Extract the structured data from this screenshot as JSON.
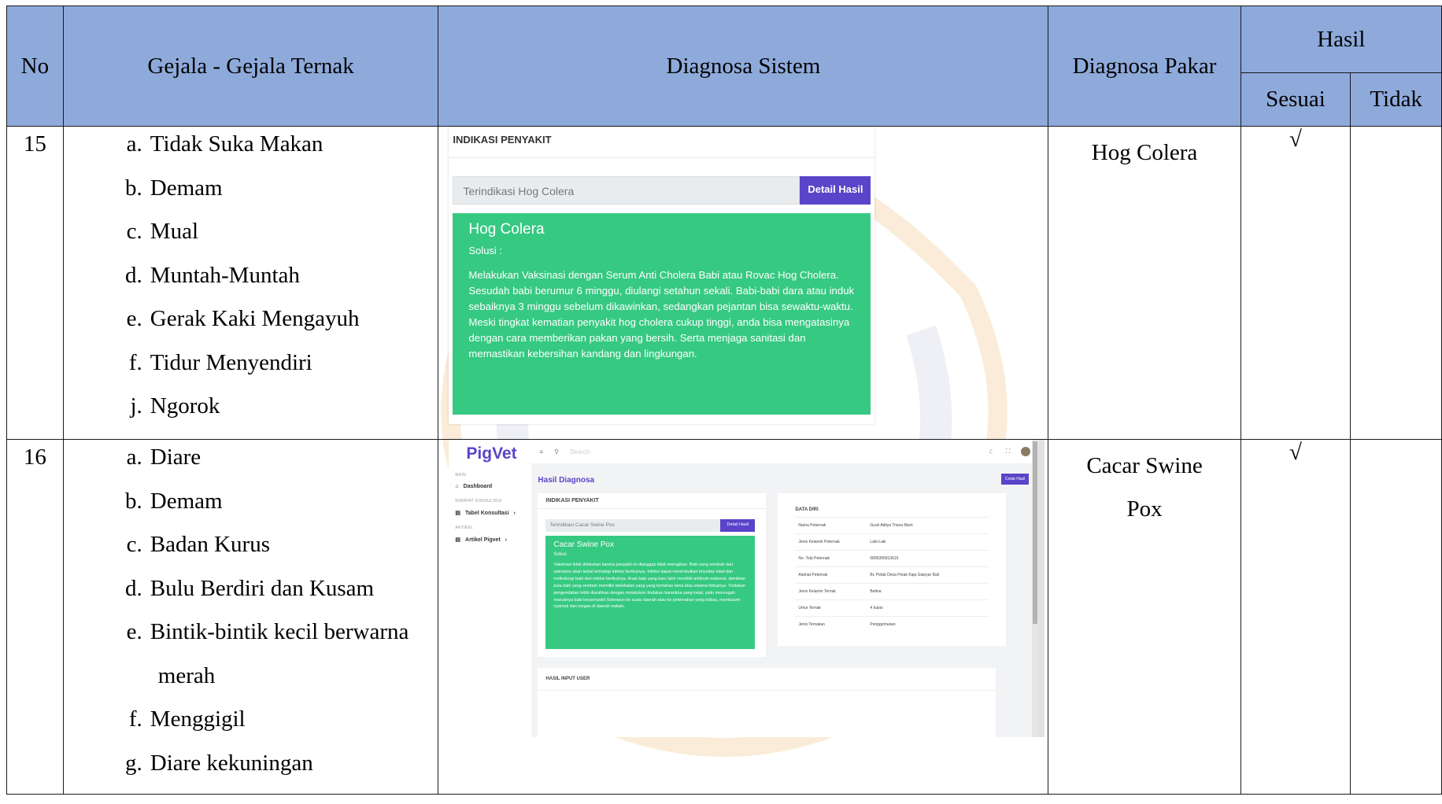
{
  "table": {
    "headers": {
      "no": "No",
      "symptoms": "Gejala - Gejala Ternak",
      "system": "Diagnosa Sistem",
      "expert": "Diagnosa Pakar",
      "result": "Hasil",
      "match": "Sesuai",
      "mismatch": "Tidak"
    },
    "rows": [
      {
        "no": "15",
        "symptoms": [
          {
            "letter": "a.",
            "text": "Tidak Suka Makan"
          },
          {
            "letter": "b.",
            "text": "Demam"
          },
          {
            "letter": "c.",
            "text": "Mual"
          },
          {
            "letter": "d.",
            "text": "Muntah-Muntah"
          },
          {
            "letter": "e.",
            "text": "Gerak Kaki Mengayuh"
          },
          {
            "letter": "f.",
            "text": "Tidur Menyendiri"
          },
          {
            "letter": "j.",
            "text": "Ngorok"
          }
        ],
        "expert": "Hog Colera",
        "match_mark": "√",
        "mismatch_mark": ""
      },
      {
        "no": "16",
        "symptoms": [
          {
            "letter": "a.",
            "text": "Diare"
          },
          {
            "letter": "b.",
            "text": "Demam"
          },
          {
            "letter": "c.",
            "text": "Badan Kurus"
          },
          {
            "letter": "d.",
            "text": "Bulu Berdiri dan Kusam"
          },
          {
            "letter": "e.",
            "text": "Bintik-bintik kecil berwarna",
            "cont": "merah"
          },
          {
            "letter": "f.",
            "text": "Menggigil"
          },
          {
            "letter": "g.",
            "text": "Diare kekuningan"
          }
        ],
        "expert_line1": "Cacar Swine",
        "expert_line2": "Pox",
        "match_mark": "√",
        "mismatch_mark": ""
      }
    ]
  },
  "shot1": {
    "header": "INDIKASI PENYAKIT",
    "input_value": "Terindikasi Hog Colera",
    "button": "Detail Hasil",
    "disease": "Hog Colera",
    "solution_label": "Solusi :",
    "solution_text": "Melakukan Vaksinasi dengan Serum Anti Cholera Babi atau Rovac Hog Cholera. Sesudah babi berumur 6 minggu, diulangi setahun sekali. Babi-babi dara atau induk sebaiknya 3 minggu sebelum dikawinkan, sedangkan pejantan bisa sewaktu-waktu. Meski tingkat kematian penyakit hog cholera cukup tinggi, anda bisa mengatasinya dengan cara memberikan pakan yang bersih. Serta menjaga sanitasi dan memastikan kebersihan kandang dan lingkungan.",
    "accent": "#36c981",
    "brand": "#5a44c9"
  },
  "shot2": {
    "logo": "PigVet",
    "sec_main": "MAIN",
    "nav_dashboard": "Dashboard",
    "sec_riwayat": "RIWAYAT KONSULTASI",
    "nav_tabel": "Tabel Konsultasi",
    "sec_artikel": "ARTIKEL",
    "nav_artikel": "Artikel Pigvet",
    "search_placeholder": "Search",
    "page_title": "Hasil Diagnosa",
    "print_button": "Cetak Hasil",
    "card_header": "INDIKASI PENYAKIT",
    "input_value": "Terindikasi Cacar Swine Pox",
    "detail_button": "Detail Hasil",
    "disease": "Cacar Swine Pox",
    "solution_label": "Solusi",
    "solution_text": "Vaksinasi tidak dilakukan karena penyakit ini dianggap tidak merugikan. Babi yang sembuh dari swinepox akan kebal terhadap infeksi berikutnya. Infeksi dapat menimbulkan imunitas lokal dan melindungi babi dari infeksi berikutnya. Anak babi yang baru lahir memiliki antibodi maternal, demikian pula babi yang sembuh memiliki kekebalan yang yang bertahan lama bisa selama hidupnya. Tindakan pengendalian lebih diarahkan dengan melakukan tindakan karantina yang ketat, yaitu mencegah masuknya babi berpenyakit Swinepox ke suatu daerah atau ke peternakan yang bebas, membasmi nyamuk dan tungau di daerah wabah.",
    "data_header": "DATA DIRI",
    "data_rows": [
      {
        "key": "Nama Peternak",
        "value": "Gusti Aditya Trisna Murti"
      },
      {
        "key": "Jenis Kelamin Peternak",
        "value": "Laki-Laki"
      },
      {
        "key": "No. Telp Peternak",
        "value": "0895395813615"
      },
      {
        "key": "Alamat Peternak",
        "value": "Br. Petak Desa Petak Kaja Gianyar Bali"
      },
      {
        "key": "Jenis Kelamin Ternak",
        "value": "Betina"
      },
      {
        "key": "Umur Ternak",
        "value": "4 bulan"
      },
      {
        "key": "Jenis Ternakan",
        "value": "Penggemukan"
      }
    ],
    "input_header": "HASIL INPUT USER"
  }
}
